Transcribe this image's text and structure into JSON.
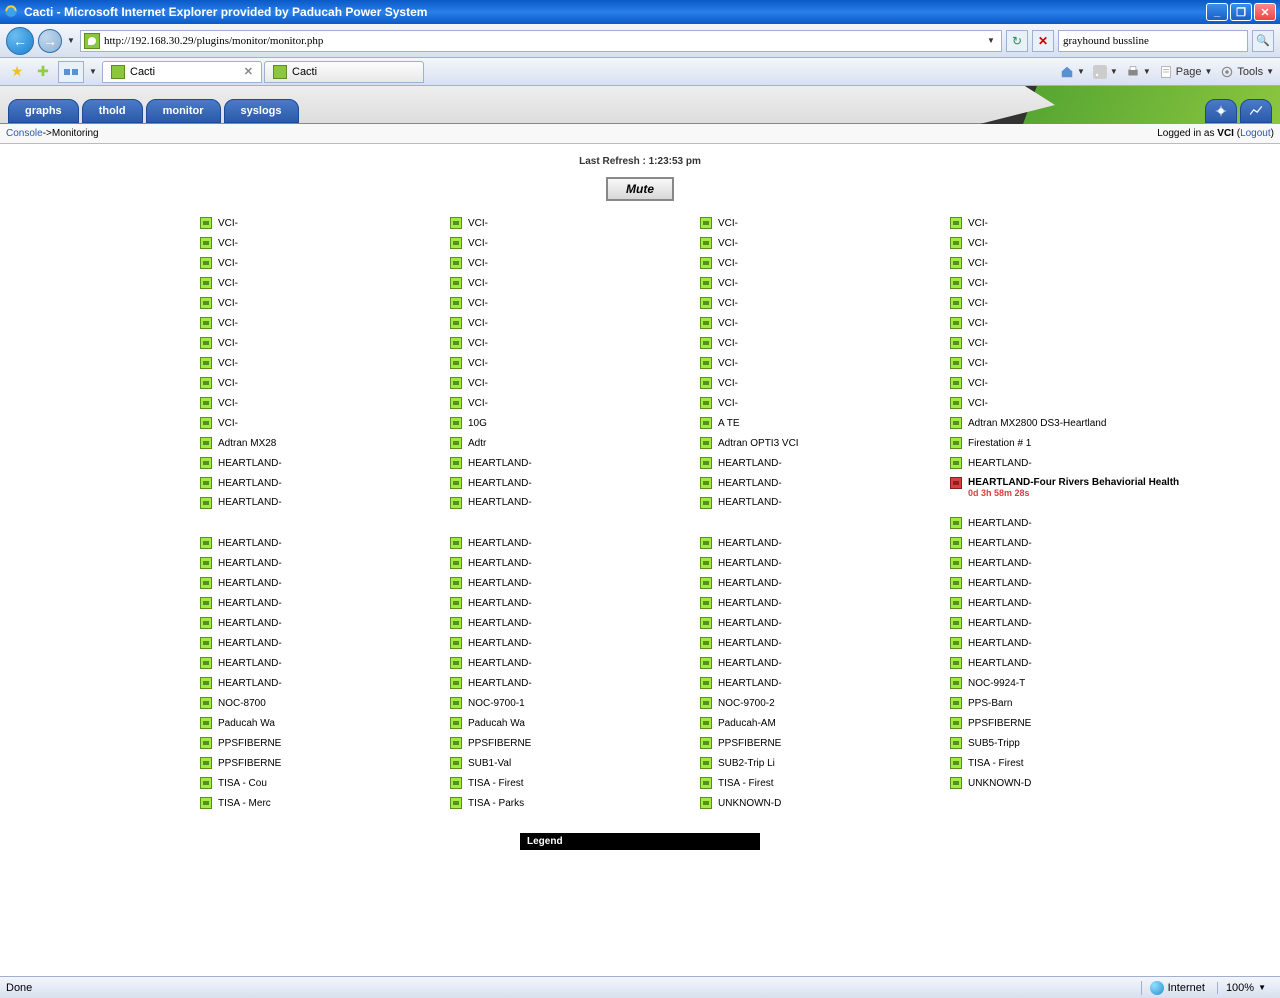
{
  "window": {
    "title": "Cacti - Microsoft Internet Explorer provided by Paducah Power System"
  },
  "nav": {
    "url": "http://192.168.30.29/plugins/monitor/monitor.php",
    "search_value": "grayhound bussline"
  },
  "tabs": [
    {
      "label": "Cacti",
      "active": true
    },
    {
      "label": "Cacti",
      "active": false
    }
  ],
  "ie_tools": {
    "page": "Page",
    "tools": "Tools"
  },
  "cacti_nav": [
    "graphs",
    "thold",
    "monitor",
    "syslogs"
  ],
  "breadcrumb": {
    "console": "Console",
    "sep": " -> ",
    "current": "Monitoring",
    "logged_prefix": "Logged in as ",
    "user": "VCI",
    "logout": "Logout"
  },
  "refresh": {
    "label": "Last Refresh : ",
    "time": "1:23:53 pm"
  },
  "mute_label": "Mute",
  "legend_label": "Legend",
  "statusbar": {
    "done": "Done",
    "zone": "Internet",
    "zoom": "100%"
  },
  "columns": [
    [
      {
        "l": "VCI-",
        "s": "up"
      },
      {
        "l": "VCI-",
        "s": "up"
      },
      {
        "l": "VCI-",
        "s": "up"
      },
      {
        "l": "VCI-",
        "s": "up"
      },
      {
        "l": "VCI-",
        "s": "up"
      },
      {
        "l": "VCI-",
        "s": "up"
      },
      {
        "l": "VCI-",
        "s": "up"
      },
      {
        "l": "VCI-",
        "s": "up"
      },
      {
        "l": "VCI-",
        "s": "up"
      },
      {
        "l": "VCI-",
        "s": "up"
      },
      {
        "l": "VCI-",
        "s": "up"
      },
      {
        "l": "Adtran MX28",
        "s": "up"
      },
      {
        "l": "HEARTLAND-",
        "s": "up"
      },
      {
        "l": "HEARTLAND-",
        "s": "up"
      },
      {
        "l": "HEARTLAND-",
        "s": "up",
        "tall": true
      },
      {
        "l": "HEARTLAND-",
        "s": "up"
      },
      {
        "l": "HEARTLAND-",
        "s": "up"
      },
      {
        "l": "HEARTLAND-",
        "s": "up"
      },
      {
        "l": "HEARTLAND-",
        "s": "up"
      },
      {
        "l": "HEARTLAND-",
        "s": "up"
      },
      {
        "l": "HEARTLAND-",
        "s": "up"
      },
      {
        "l": "HEARTLAND-",
        "s": "up"
      },
      {
        "l": "HEARTLAND-",
        "s": "up"
      },
      {
        "l": "NOC-8700",
        "s": "up"
      },
      {
        "l": "Paducah Wa",
        "s": "up"
      },
      {
        "l": "PPSFIBERNE",
        "s": "up"
      },
      {
        "l": "PPSFIBERNE",
        "s": "up"
      },
      {
        "l": "TISA - Cou",
        "s": "up"
      },
      {
        "l": "TISA - Merc",
        "s": "up"
      }
    ],
    [
      {
        "l": "VCI-",
        "s": "up"
      },
      {
        "l": "VCI-",
        "s": "up"
      },
      {
        "l": "VCI-",
        "s": "up"
      },
      {
        "l": "VCI-",
        "s": "up"
      },
      {
        "l": "VCI-",
        "s": "up"
      },
      {
        "l": "VCI-",
        "s": "up"
      },
      {
        "l": "VCI-",
        "s": "up"
      },
      {
        "l": "VCI-",
        "s": "up"
      },
      {
        "l": "VCI-",
        "s": "up"
      },
      {
        "l": "VCI-",
        "s": "up"
      },
      {
        "l": "10G",
        "s": "up"
      },
      {
        "l": "Adtr",
        "s": "up"
      },
      {
        "l": "HEARTLAND-",
        "s": "up"
      },
      {
        "l": "HEARTLAND-",
        "s": "up"
      },
      {
        "l": "HEARTLAND-",
        "s": "up",
        "tall": true
      },
      {
        "l": "HEARTLAND-",
        "s": "up"
      },
      {
        "l": "HEARTLAND-",
        "s": "up"
      },
      {
        "l": "HEARTLAND-",
        "s": "up"
      },
      {
        "l": "HEARTLAND-",
        "s": "up"
      },
      {
        "l": "HEARTLAND-",
        "s": "up"
      },
      {
        "l": "HEARTLAND-",
        "s": "up"
      },
      {
        "l": "HEARTLAND-",
        "s": "up"
      },
      {
        "l": "HEARTLAND-",
        "s": "up"
      },
      {
        "l": "NOC-9700-1",
        "s": "up"
      },
      {
        "l": "Paducah Wa",
        "s": "up"
      },
      {
        "l": "PPSFIBERNE",
        "s": "up"
      },
      {
        "l": "SUB1-Val",
        "s": "up"
      },
      {
        "l": "TISA - Firest",
        "s": "up"
      },
      {
        "l": "TISA - Parks",
        "s": "up"
      }
    ],
    [
      {
        "l": "VCI-",
        "s": "up"
      },
      {
        "l": "VCI-",
        "s": "up"
      },
      {
        "l": "VCI-",
        "s": "up"
      },
      {
        "l": "VCI-",
        "s": "up"
      },
      {
        "l": "VCI-",
        "s": "up"
      },
      {
        "l": "VCI-",
        "s": "up"
      },
      {
        "l": "VCI-",
        "s": "up"
      },
      {
        "l": "VCI-",
        "s": "up"
      },
      {
        "l": "VCI-",
        "s": "up"
      },
      {
        "l": "VCI-",
        "s": "up"
      },
      {
        "l": "A TE",
        "s": "up"
      },
      {
        "l": "Adtran OPTI3 VCI",
        "s": "up"
      },
      {
        "l": "HEARTLAND-",
        "s": "up"
      },
      {
        "l": "HEARTLAND-",
        "s": "up"
      },
      {
        "l": "HEARTLAND-",
        "s": "up",
        "tall": true
      },
      {
        "l": "HEARTLAND-",
        "s": "up"
      },
      {
        "l": "HEARTLAND-",
        "s": "up"
      },
      {
        "l": "HEARTLAND-",
        "s": "up"
      },
      {
        "l": "HEARTLAND-",
        "s": "up"
      },
      {
        "l": "HEARTLAND-",
        "s": "up"
      },
      {
        "l": "HEARTLAND-",
        "s": "up"
      },
      {
        "l": "HEARTLAND-",
        "s": "up"
      },
      {
        "l": "HEARTLAND-",
        "s": "up"
      },
      {
        "l": "NOC-9700-2",
        "s": "up"
      },
      {
        "l": "Paducah-AM",
        "s": "up"
      },
      {
        "l": "PPSFIBERNE",
        "s": "up"
      },
      {
        "l": "SUB2-Trip Li",
        "s": "up"
      },
      {
        "l": "TISA - Firest",
        "s": "up"
      },
      {
        "l": "UNKNOWN-D",
        "s": "up"
      }
    ],
    [
      {
        "l": "VCI-",
        "s": "up"
      },
      {
        "l": "VCI-",
        "s": "up"
      },
      {
        "l": "VCI-",
        "s": "up"
      },
      {
        "l": "VCI-",
        "s": "up"
      },
      {
        "l": "VCI-",
        "s": "up"
      },
      {
        "l": "VCI-",
        "s": "up"
      },
      {
        "l": "VCI-",
        "s": "up"
      },
      {
        "l": "VCI-",
        "s": "up"
      },
      {
        "l": "VCI-",
        "s": "up"
      },
      {
        "l": "VCI-",
        "s": "up"
      },
      {
        "l": "Adtran MX2800 DS3-Heartland",
        "s": "up"
      },
      {
        "l": "Firestation # 1",
        "s": "up"
      },
      {
        "l": "HEARTLAND-",
        "s": "up"
      },
      {
        "l": "HEARTLAND-Four Rivers Behaviorial Health",
        "s": "down",
        "bold": true,
        "time": "0d 3h 58m 28s",
        "tall": true
      },
      {
        "l": "HEARTLAND-",
        "s": "up"
      },
      {
        "l": "HEARTLAND-",
        "s": "up"
      },
      {
        "l": "HEARTLAND-",
        "s": "up"
      },
      {
        "l": "HEARTLAND-",
        "s": "up"
      },
      {
        "l": "HEARTLAND-",
        "s": "up"
      },
      {
        "l": "HEARTLAND-",
        "s": "up"
      },
      {
        "l": "HEARTLAND-",
        "s": "up"
      },
      {
        "l": "HEARTLAND-",
        "s": "up"
      },
      {
        "l": "NOC-9924-T",
        "s": "up"
      },
      {
        "l": "PPS-Barn",
        "s": "up"
      },
      {
        "l": "PPSFIBERNE",
        "s": "up"
      },
      {
        "l": "SUB5-Tripp",
        "s": "up"
      },
      {
        "l": "TISA - Firest",
        "s": "up"
      },
      {
        "l": "UNKNOWN-D",
        "s": "up"
      }
    ]
  ]
}
